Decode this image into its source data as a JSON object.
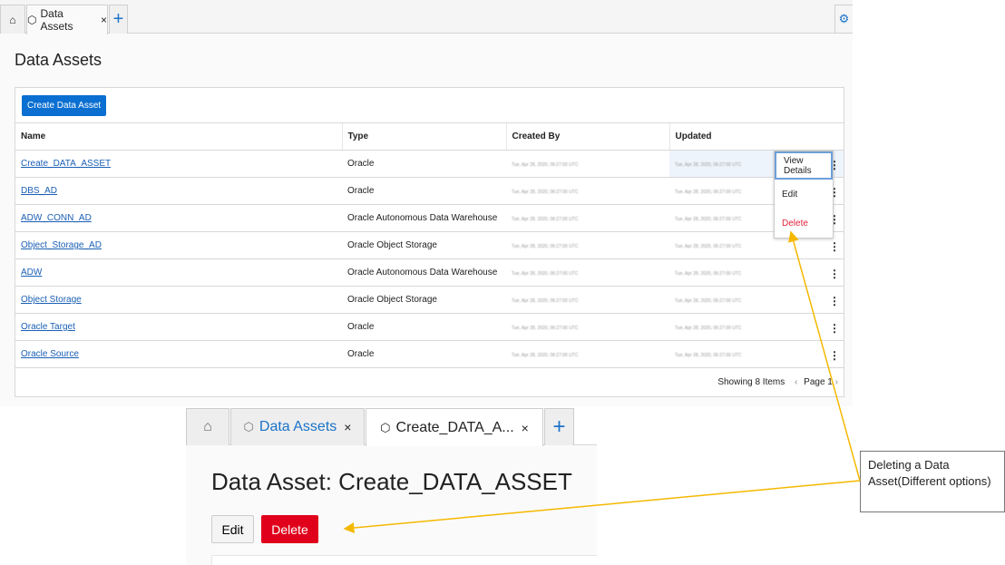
{
  "list_view": {
    "tabs": [
      {
        "label": "Data Assets"
      }
    ],
    "title": "Data Assets",
    "create_button": "Create Data Asset",
    "columns": [
      "Name",
      "Type",
      "Created By",
      "Updated"
    ],
    "rows": [
      {
        "name": "Create_DATA_ASSET",
        "type": "Oracle",
        "created_by": "Tue, Apr 28, 2020, 06:27:00 UTC",
        "updated": "Tue, Apr 28, 2020, 06:27:00 UTC"
      },
      {
        "name": "DBS_AD",
        "type": "Oracle",
        "created_by": "Tue, Apr 28, 2020, 06:27:00 UTC",
        "updated": "Tue, Apr 28, 2020, 06:27:00 UTC"
      },
      {
        "name": "ADW_CONN_AD",
        "type": "Oracle Autonomous Data Warehouse",
        "created_by": "Tue, Apr 28, 2020, 06:27:00 UTC",
        "updated": "Tue, Apr 28, 2020, 06:27:00 UTC"
      },
      {
        "name": "Object_Storage_AD",
        "type": "Oracle Object Storage",
        "created_by": "Tue, Apr 28, 2020, 06:27:00 UTC",
        "updated": "Tue, Apr 28, 2020, 06:27:00 UTC"
      },
      {
        "name": "ADW",
        "type": "Oracle Autonomous Data Warehouse",
        "created_by": "Tue, Apr 28, 2020, 06:27:00 UTC",
        "updated": "Tue, Apr 28, 2020, 06:27:00 UTC"
      },
      {
        "name": "Object Storage",
        "type": "Oracle Object Storage",
        "created_by": "Tue, Apr 28, 2020, 06:27:00 UTC",
        "updated": "Tue, Apr 28, 2020, 06:27:00 UTC"
      },
      {
        "name": "Oracle Target",
        "type": "Oracle",
        "created_by": "Tue, Apr 28, 2020, 06:27:00 UTC",
        "updated": "Tue, Apr 28, 2020, 06:27:00 UTC"
      },
      {
        "name": "Oracle Source",
        "type": "Oracle",
        "created_by": "Tue, Apr 28, 2020, 06:27:00 UTC",
        "updated": "Tue, Apr 28, 2020, 06:27:00 UTC"
      }
    ],
    "menu": [
      "View Details",
      "Edit",
      "Delete"
    ],
    "footer": {
      "count": "Showing 8 Items",
      "page": "Page 1"
    }
  },
  "detail_view": {
    "tabs": [
      {
        "label": "Data Assets"
      },
      {
        "label": "Create_DATA_A..."
      }
    ],
    "title": "Data Asset: Create_DATA_ASSET",
    "edit_button": "Edit",
    "delete_button": "Delete"
  },
  "callout": "Deleting a Data Asset(Different options)",
  "colors": {
    "primary": "#0a6fd1",
    "danger": "#e0001b",
    "arrow": "#f5b800"
  }
}
